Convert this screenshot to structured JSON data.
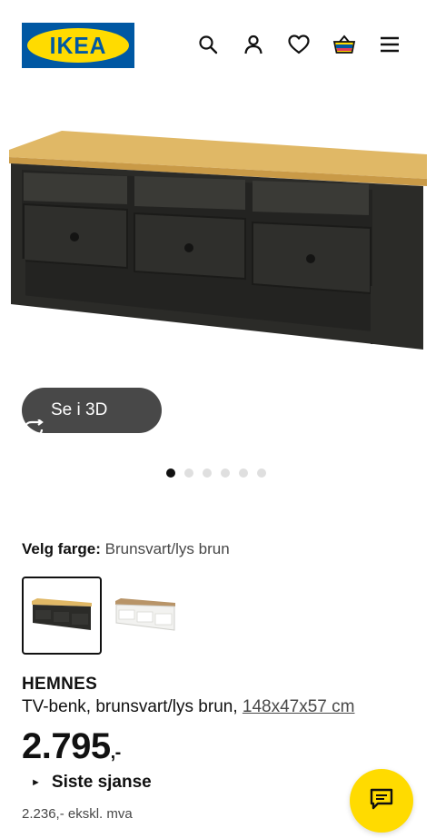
{
  "header": {
    "logo_text": "IKEA",
    "icons": [
      "search-icon",
      "profile-icon",
      "heart-icon",
      "basket-icon",
      "menu-icon"
    ]
  },
  "hero": {
    "view_3d_label": "Se i 3D",
    "image_count": 6,
    "active_image": 1
  },
  "color": {
    "label": "Velg farge:",
    "value": "Brunsvart/lys brun",
    "swatch_count": 2,
    "selected_swatch": 1
  },
  "product": {
    "name": "HEMNES",
    "description": "TV-benk, brunsvart/lys brun,",
    "dimensions": "148x47x57 cm",
    "price_main": "2.795",
    "price_suffix": ",-",
    "last_chance": "Siste sjanse",
    "price_ex_vat": "2.236,- ekskl. mva"
  },
  "colors": {
    "ikea_blue": "#0058a3",
    "ikea_yellow": "#ffdb00",
    "dark_button": "#484848"
  }
}
